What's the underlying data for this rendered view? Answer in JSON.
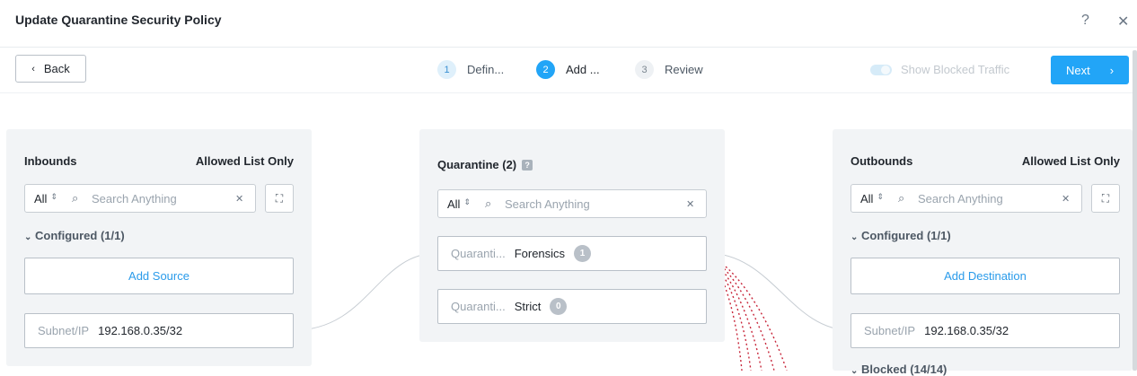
{
  "header": {
    "title": "Update Quarantine Security Policy",
    "help_icon": "?",
    "close_icon": "✕"
  },
  "toolbar": {
    "back_label": "Back",
    "next_label": "Next",
    "show_blocked_label": "Show Blocked Traffic"
  },
  "steps": [
    {
      "num": "1",
      "label": "Defin..."
    },
    {
      "num": "2",
      "label": "Add ..."
    },
    {
      "num": "3",
      "label": "Review"
    }
  ],
  "inbounds": {
    "title": "Inbounds",
    "mode": "Allowed List Only",
    "filter": "All",
    "search_placeholder": "Search Anything",
    "section": "Configured (1/1)",
    "add_label": "Add Source",
    "entries": [
      {
        "key": "Subnet/IP",
        "value": "192.168.0.35/32"
      }
    ]
  },
  "quarantine": {
    "title": "Quarantine (2)",
    "filter": "All",
    "search_placeholder": "Search Anything",
    "items": [
      {
        "key": "Quaranti...",
        "value": "Forensics",
        "count": "1"
      },
      {
        "key": "Quaranti...",
        "value": "Strict",
        "count": "0"
      }
    ]
  },
  "outbounds": {
    "title": "Outbounds",
    "mode": "Allowed List Only",
    "filter": "All",
    "search_placeholder": "Search Anything",
    "section": "Configured (1/1)",
    "add_label": "Add Destination",
    "entries": [
      {
        "key": "Subnet/IP",
        "value": "192.168.0.35/32"
      }
    ],
    "blocked_section": "Blocked (14/14)"
  },
  "colors": {
    "accent": "#22a5f7",
    "link": "#2a9bea",
    "blocked_line": "#c8283c",
    "panel_bg": "#f2f4f6"
  }
}
